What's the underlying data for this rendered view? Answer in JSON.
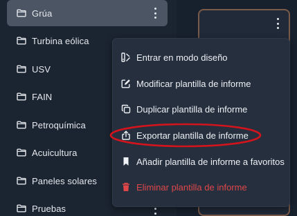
{
  "sidebar": {
    "items": [
      {
        "label": "Grúa",
        "icon": "folder-icon",
        "selected": true
      },
      {
        "label": "Turbina eólica",
        "icon": "folder-icon"
      },
      {
        "label": "USV",
        "icon": "folder-icon"
      },
      {
        "label": "FAIN",
        "icon": "folder-icon"
      },
      {
        "label": "Petroquímica",
        "icon": "folder-icon"
      },
      {
        "label": "Acuicultura",
        "icon": "folder-icon"
      },
      {
        "label": "Paneles solares",
        "icon": "folder-icon"
      },
      {
        "label": "Pruebas",
        "icon": "folder-icon"
      }
    ]
  },
  "context_menu": {
    "items": [
      {
        "label": "Entrar en modo diseño",
        "icon": "design-mode-icon"
      },
      {
        "label": "Modificar plantilla de informe",
        "icon": "edit-icon"
      },
      {
        "label": "Duplicar plantilla de informe",
        "icon": "duplicate-icon"
      },
      {
        "label": "Exportar plantilla de informe",
        "icon": "export-icon",
        "highlighted": true
      },
      {
        "label": "Añadir plantilla de informe a favoritos",
        "icon": "bookmark-icon"
      },
      {
        "label": "Eliminar plantilla de informe",
        "icon": "trash-icon",
        "danger": true
      }
    ]
  },
  "colors": {
    "background": "#17202d",
    "selected_item": "#4b5563",
    "menu_background": "#252f3d",
    "danger": "#e0474a",
    "annotation": "#d4141c",
    "card_border": "#7a5a49"
  }
}
